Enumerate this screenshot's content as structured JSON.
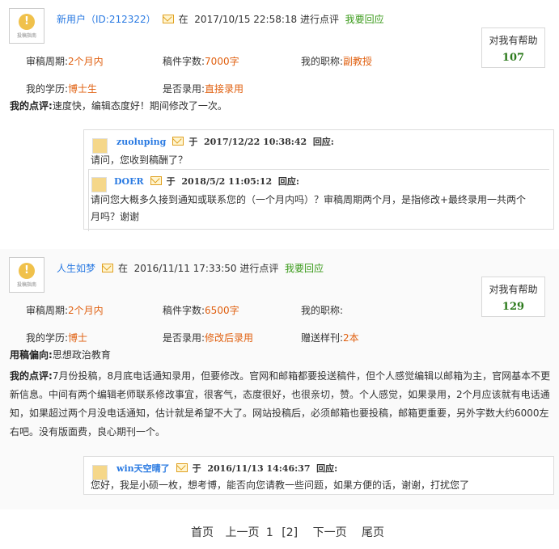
{
  "reviews": [
    {
      "avatar_caption": "投稿指南",
      "user": "新用户（ID:212322）",
      "at_label": "在",
      "datetime": "2017/10/15 22:58:18",
      "action": "进行点评",
      "respond": "我要回应",
      "help_label": "对我有帮助",
      "help_count": "107",
      "period_label": "审稿周期:",
      "period_value": "2个月内",
      "words_label": "稿件字数:",
      "words_value": "7000字",
      "title_label": "我的职称:",
      "title_value": "副教授",
      "degree_label": "我的学历:",
      "degree_value": "博士生",
      "accepted_label": "是否录用:",
      "accepted_value": "直接录用",
      "comment_label": "我的点评:",
      "comment": "速度快，编辑态度好！期间修改了一次。",
      "replies": [
        {
          "user": "zuoluping",
          "yu": "于",
          "datetime": "2017/12/22 10:38:42",
          "respond_label": "回应:",
          "text": "请问，您收到稿酬了？"
        },
        {
          "user": "DOER",
          "yu": "于",
          "datetime": "2018/5/2 11:05:12",
          "respond_label": "回应:",
          "text": "请问您大概多久接到通知或联系您的（一个月内吗）？审稿周期两个月，是指修改+最终录用一共两个月吗？谢谢"
        }
      ]
    },
    {
      "avatar_caption": "投稿指南",
      "user": "人生如梦",
      "at_label": "在",
      "datetime": "2016/11/11 17:33:50",
      "action": "进行点评",
      "respond": "我要回应",
      "help_label": "对我有帮助",
      "help_count": "129",
      "period_label": "审稿周期:",
      "period_value": "2个月内",
      "words_label": "稿件字数:",
      "words_value": "6500字",
      "title_label": "我的职称:",
      "title_value": "",
      "degree_label": "我的学历:",
      "degree_value": "博士",
      "accepted_label": "是否录用:",
      "accepted_value": "修改后录用",
      "sample_label": "赠送样刊:",
      "sample_value": "2本",
      "bias_label": "用稿偏向:",
      "bias_value": "思想政治教育",
      "comment_label": "我的点评:",
      "comment": "7月份投稿，8月底电话通知录用，但要修改。官网和邮箱都要投送稿件，但个人感觉编辑以邮箱为主，官网基本不更新信息。中间有两个编辑老师联系修改事宜，很客气，态度很好，也很亲切，赞。个人感觉，如果录用，2个月应该就有电话通知，如果超过两个月没电话通知，估计就是希望不大了。网站投稿后，必须邮箱也要投稿，邮箱更重要，另外字数大约6000左右吧。没有版面费，良心期刊一个。",
      "replies": [
        {
          "user": "win天空晴了",
          "yu": "于",
          "datetime": "2016/11/13 14:46:37",
          "respond_label": "回应:",
          "text": "您好，我是小硕一枚，想考博，能否向您请教一些问题，如果方便的话，谢谢，打扰您了"
        }
      ]
    }
  ],
  "pager": {
    "first": "首页",
    "prev": "上一页",
    "page1": "1",
    "page2": "[2]",
    "next": "下一页",
    "last": "尾页"
  },
  "colors": {
    "link": "#2a7ae2",
    "value": "#e06010",
    "green": "#3a9a1a",
    "count": "#2c7a1c"
  }
}
